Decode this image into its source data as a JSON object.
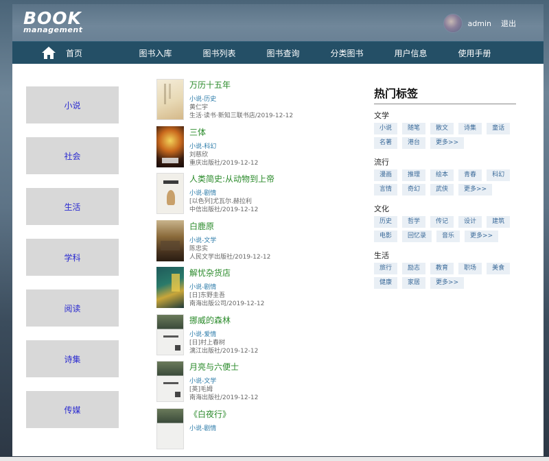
{
  "header": {
    "logo_big": "BOOK",
    "logo_small": "management",
    "username": "admin",
    "logout_label": "退出"
  },
  "nav": {
    "home": "首页",
    "items": [
      "图书入库",
      "图书列表",
      "图书查询",
      "分类图书",
      "用户信息",
      "使用手册"
    ]
  },
  "categories": [
    "小说",
    "社会",
    "生活",
    "学科",
    "阅读",
    "诗集",
    "传媒"
  ],
  "books": [
    {
      "title": "万历十五年",
      "tag": "小说-历史",
      "author": "黄仁宇",
      "publisher": "生活·读书·新知三联书店/2019-12-12"
    },
    {
      "title": "三体",
      "tag": "小说-科幻",
      "author": "刘慈欣",
      "publisher": "重庆出版社/2019-12-12"
    },
    {
      "title": "人类简史:从动物到上帝",
      "tag": "小说-剧情",
      "author": "[以色列]尤瓦尔.赫拉利",
      "publisher": "中信出版社/2019-12-12"
    },
    {
      "title": "白鹿原",
      "tag": "小说-文学",
      "author": "陈忠实",
      "publisher": "人民文学出版社/2019-12-12"
    },
    {
      "title": "解忧杂货店",
      "tag": "小说-剧情",
      "author": "[日]东野圭吾",
      "publisher": "南海出版公司/2019-12-12"
    },
    {
      "title": "挪威的森林",
      "tag": "小说-爱情",
      "author": "[日]村上春树",
      "publisher": "漓江出版社/2019-12-12"
    },
    {
      "title": "月亮与六便士",
      "tag": "小说-文学",
      "author": "[英]毛姆",
      "publisher": "南海出版社/2019-12-12"
    },
    {
      "title": "《白夜行》",
      "tag": "小说-剧情",
      "author": "",
      "publisher": ""
    }
  ],
  "hot_tags": {
    "title": "热门标签",
    "groups": [
      {
        "label": "文学",
        "tags": [
          "小说",
          "随笔",
          "散文",
          "诗集",
          "童话",
          "名著",
          "港台",
          "更多>>"
        ]
      },
      {
        "label": "流行",
        "tags": [
          "漫画",
          "推理",
          "绘本",
          "青春",
          "科幻",
          "言情",
          "奇幻",
          "武侠",
          "更多>>"
        ]
      },
      {
        "label": "文化",
        "tags": [
          "历史",
          "哲学",
          "传记",
          "设计",
          "建筑",
          "电影",
          "回忆录",
          "音乐",
          "更多>>"
        ]
      },
      {
        "label": "生活",
        "tags": [
          "旅行",
          "励志",
          "教育",
          "职场",
          "美食",
          "健康",
          "家居",
          "更多>>"
        ]
      }
    ]
  },
  "colors": {
    "nav_bg": "#244f66",
    "book_title": "#2a8a2a",
    "category_text": "#2a2ad0",
    "tag_text": "#3a6a99"
  }
}
